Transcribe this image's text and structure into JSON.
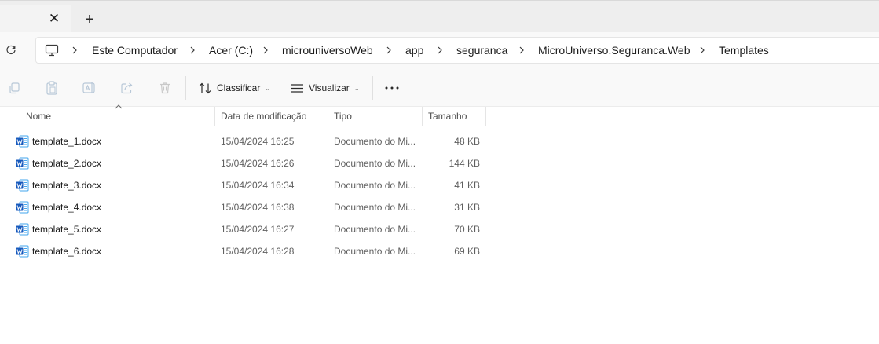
{
  "tabs": {
    "close_glyph": "✕",
    "new_tab_glyph": "+"
  },
  "breadcrumb": {
    "items": [
      "Este Computador",
      "Acer (C:)",
      "microuniversoWeb",
      "app",
      "seguranca",
      "MicroUniverso.Seguranca.Web",
      "Templates"
    ]
  },
  "toolbar": {
    "sort_label": "Classificar",
    "view_label": "Visualizar",
    "more_glyph": "⋯"
  },
  "columns": {
    "name": "Nome",
    "date": "Data de modificação",
    "type": "Tipo",
    "size": "Tamanho"
  },
  "files": [
    {
      "name": "template_1.docx",
      "date": "15/04/2024 16:25",
      "type": "Documento do Mi...",
      "size": "48 KB"
    },
    {
      "name": "template_2.docx",
      "date": "15/04/2024 16:26",
      "type": "Documento do Mi...",
      "size": "144 KB"
    },
    {
      "name": "template_3.docx",
      "date": "15/04/2024 16:34",
      "type": "Documento do Mi...",
      "size": "41 KB"
    },
    {
      "name": "template_4.docx",
      "date": "15/04/2024 16:38",
      "type": "Documento do Mi...",
      "size": "31 KB"
    },
    {
      "name": "template_5.docx",
      "date": "15/04/2024 16:27",
      "type": "Documento do Mi...",
      "size": "70 KB"
    },
    {
      "name": "template_6.docx",
      "date": "15/04/2024 16:28",
      "type": "Documento do Mi...",
      "size": "69 KB"
    }
  ],
  "icons": {
    "computer": "computer-icon",
    "refresh": "refresh-icon",
    "file": "word-document-icon"
  },
  "colors": {
    "word_blue": "#185abd",
    "word_light": "#41a5ee"
  }
}
